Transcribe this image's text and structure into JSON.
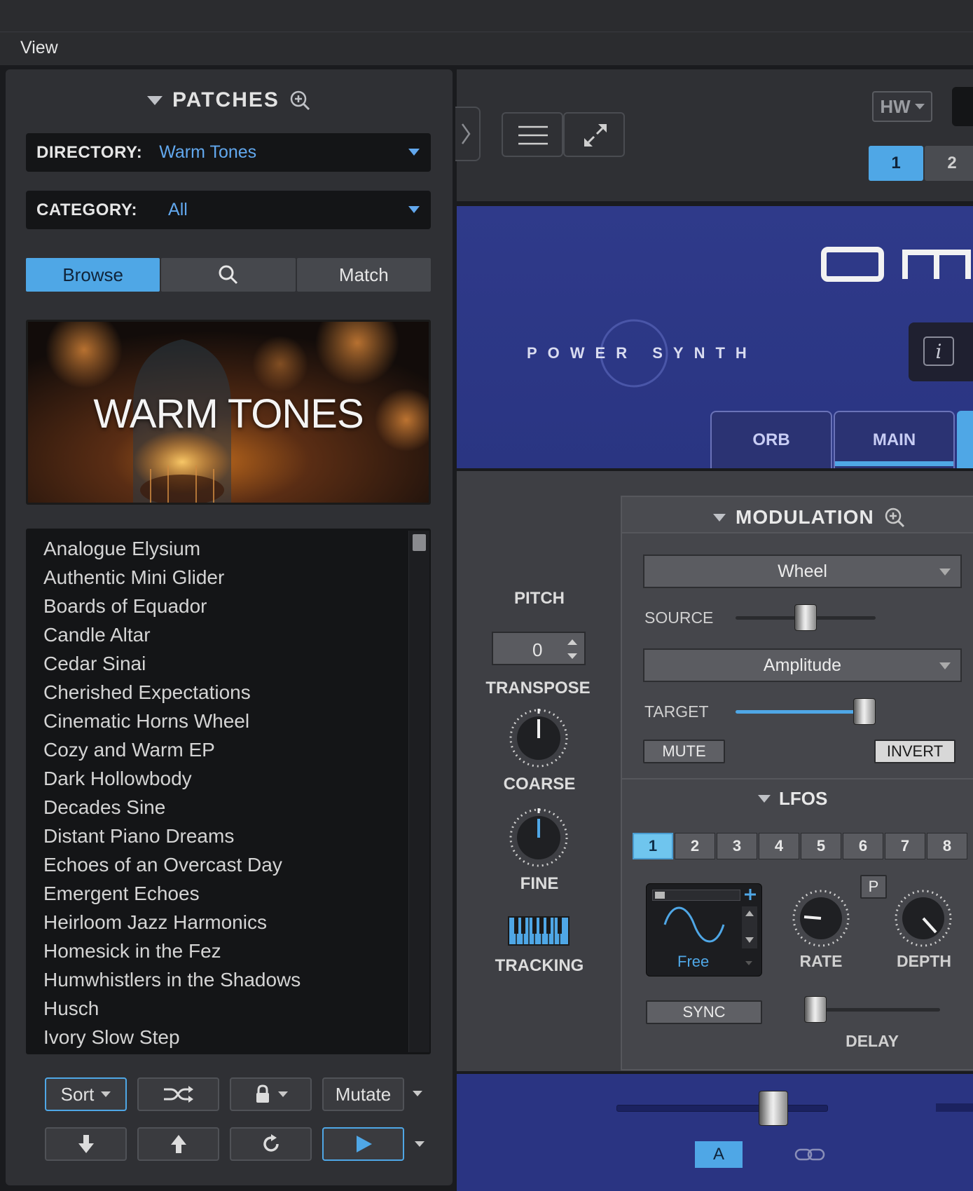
{
  "menu": {
    "view": "View"
  },
  "patches": {
    "title": "PATCHES",
    "directory_label": "DIRECTORY:",
    "directory_value": "Warm Tones",
    "category_label": "CATEGORY:",
    "category_value": "All",
    "tabs": {
      "browse": "Browse",
      "match": "Match"
    },
    "banner_text": "WARM TONES",
    "list": [
      "Analogue Elysium",
      "Authentic Mini Glider",
      "Boards of Equador",
      "Candle Altar",
      "Cedar Sinai",
      "Cherished Expectations",
      "Cinematic Horns Wheel",
      "Cozy and Warm EP",
      "Dark Hollowbody",
      "Decades Sine",
      "Distant Piano Dreams",
      "Echoes of an Overcast Day",
      "Emergent Echoes",
      "Heirloom Jazz Harmonics",
      "Homesick in the Fez",
      "Humwhistlers in the Shadows",
      "Husch",
      "Ivory Slow Step"
    ],
    "toolbar": {
      "sort": "Sort",
      "mutate": "Mutate"
    }
  },
  "header": {
    "hw": "HW",
    "part_tabs": [
      "1",
      "2"
    ],
    "brand_subtitle": "POWER SYNTH",
    "tabs": {
      "orb": "ORB",
      "main": "MAIN"
    }
  },
  "pitch": {
    "title": "PITCH",
    "transpose_value": "0",
    "transpose_label": "TRANSPOSE",
    "coarse_label": "COARSE",
    "fine_label": "FINE",
    "tracking_label": "TRACKING"
  },
  "modulation": {
    "title": "MODULATION",
    "source_value": "Wheel",
    "source_label": "SOURCE",
    "target_value": "Amplitude",
    "target_label": "TARGET",
    "mute": "MUTE",
    "invert": "INVERT",
    "source_level": 0.5,
    "target_level": 0.92
  },
  "lfos": {
    "title": "LFOS",
    "tabs": [
      "1",
      "2",
      "3",
      "4",
      "5",
      "6",
      "7",
      "8"
    ],
    "active_tab": "1",
    "p_label": "P",
    "mode": "Free",
    "rate_label": "RATE",
    "depth_label": "DEPTH",
    "sync": "SYNC",
    "delay_label": "DELAY"
  },
  "bottom": {
    "a_label": "A"
  },
  "colors": {
    "accent": "#4fa7e6",
    "brand_blue": "#2f3a8a",
    "list_text": "#d4d4d4"
  }
}
